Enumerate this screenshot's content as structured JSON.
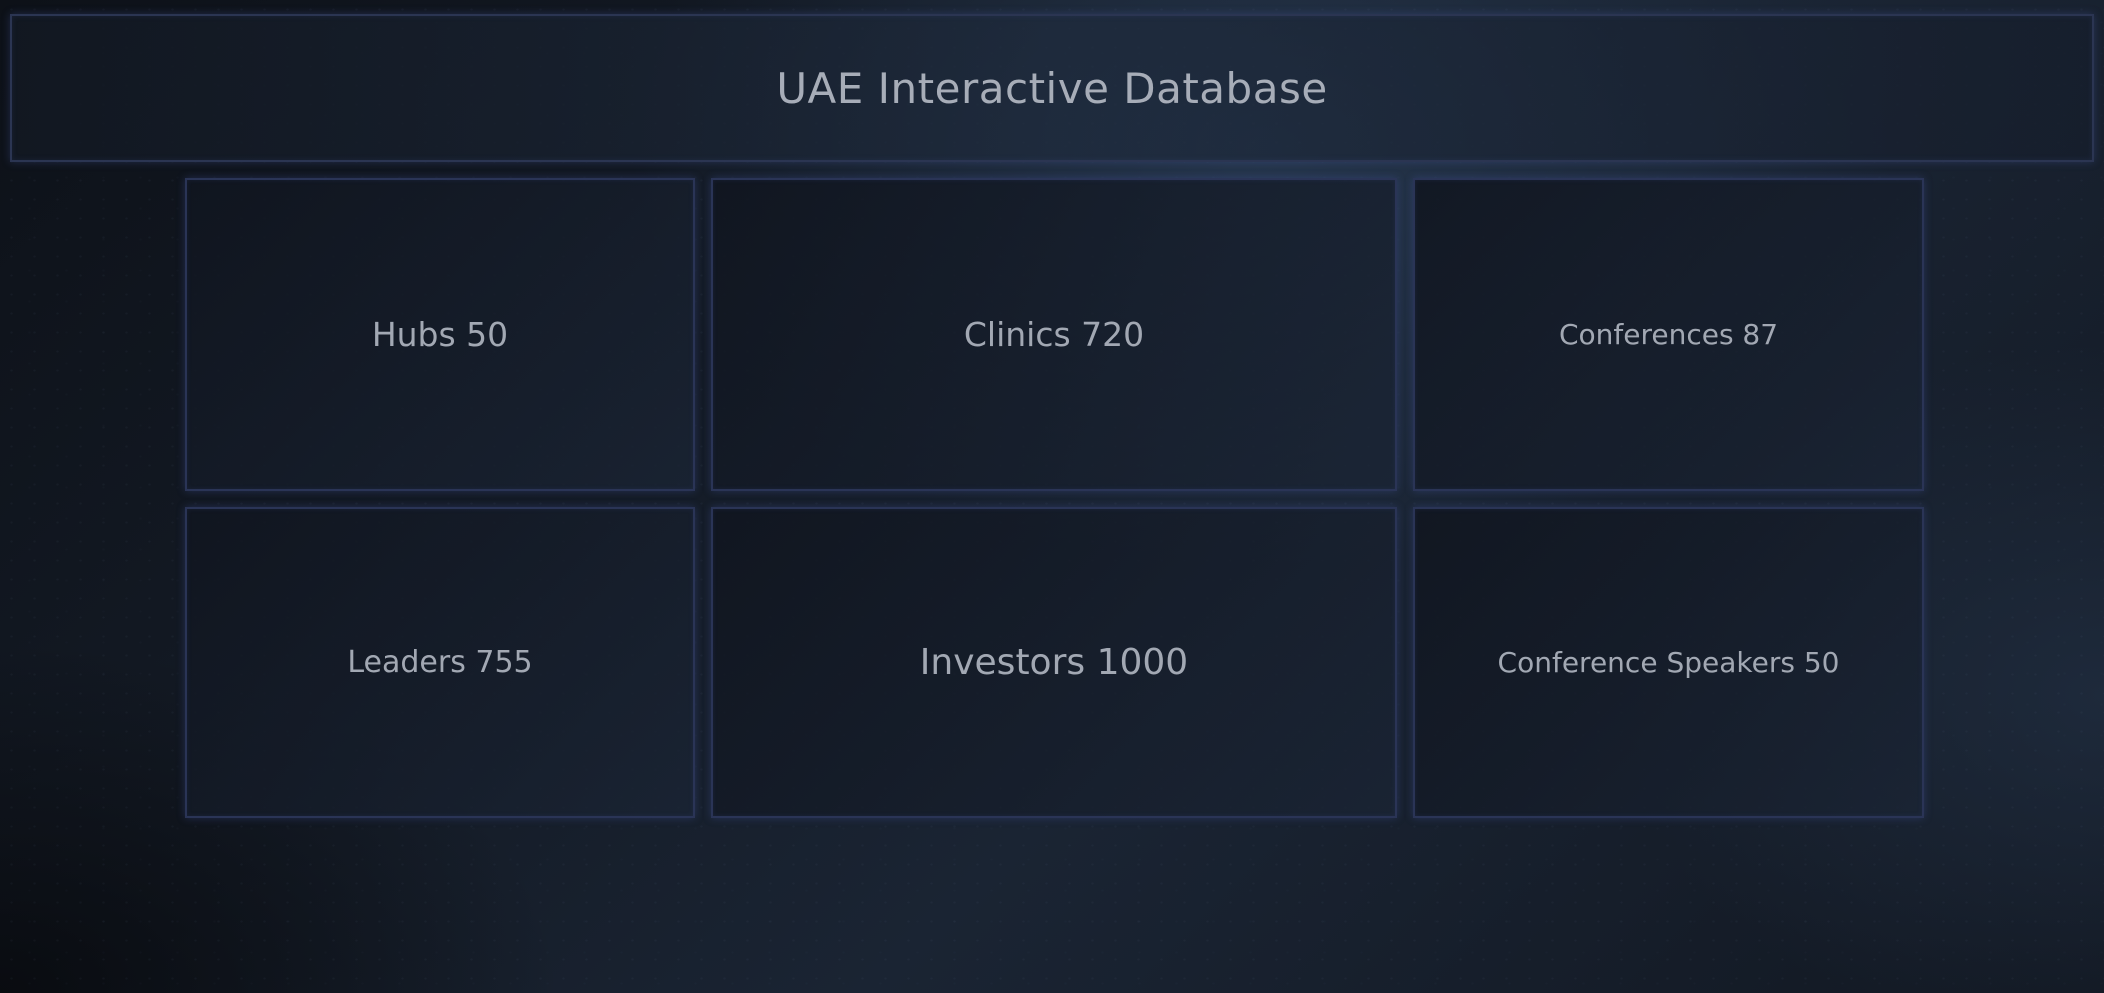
{
  "header": {
    "title": "UAE Interactive Database"
  },
  "tiles": [
    {
      "label": "Hubs 50"
    },
    {
      "label": "Clinics 720"
    },
    {
      "label": "Conferences 87"
    },
    {
      "label": "Leaders 755"
    },
    {
      "label": "Investors 1000"
    },
    {
      "label": "Conference Speakers 50"
    }
  ],
  "colors": {
    "tile_border": "#2a3456",
    "text": "#a2a8b3",
    "background": "#141b26"
  }
}
